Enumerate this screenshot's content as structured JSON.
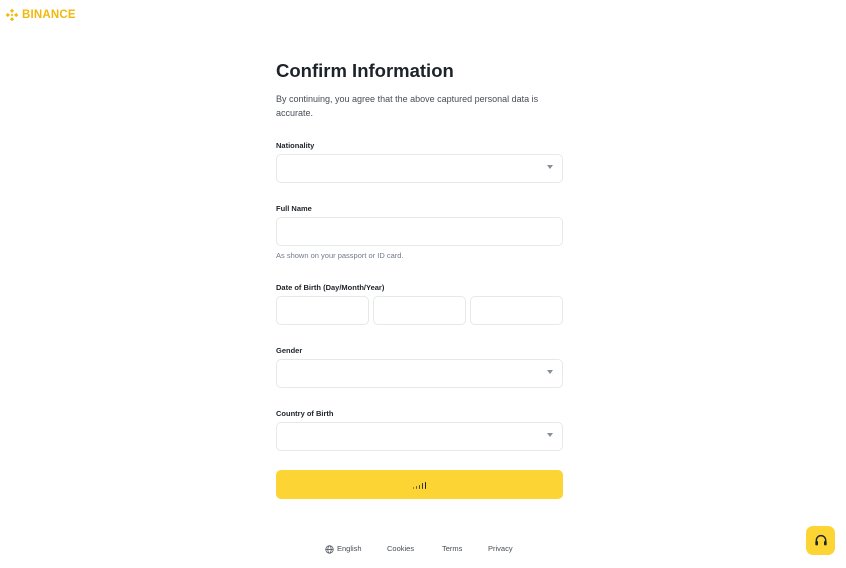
{
  "brand": {
    "name": "BINANCE",
    "color": "#f0b90b"
  },
  "page": {
    "title": "Confirm Information",
    "subtitle": "By continuing, you agree that the above captured personal data is accurate."
  },
  "form": {
    "nationality_label": "Nationality",
    "nationality_value": "",
    "full_name_label": "Full Name",
    "full_name_value": "",
    "full_name_hint": "As shown on your passport or ID card.",
    "dob_label": "Date of Birth (Day/Month/Year)",
    "dob_day": "",
    "dob_month": "",
    "dob_year": "",
    "gender_label": "Gender",
    "gender_value": "",
    "country_label": "Country of Birth",
    "country_value": "",
    "submit_state": "loading",
    "submit_color": "#fcd535"
  },
  "footer": {
    "language": "English",
    "cookies": "Cookies",
    "terms": "Terms",
    "privacy": "Privacy"
  },
  "support": {
    "icon": "headset-icon"
  }
}
